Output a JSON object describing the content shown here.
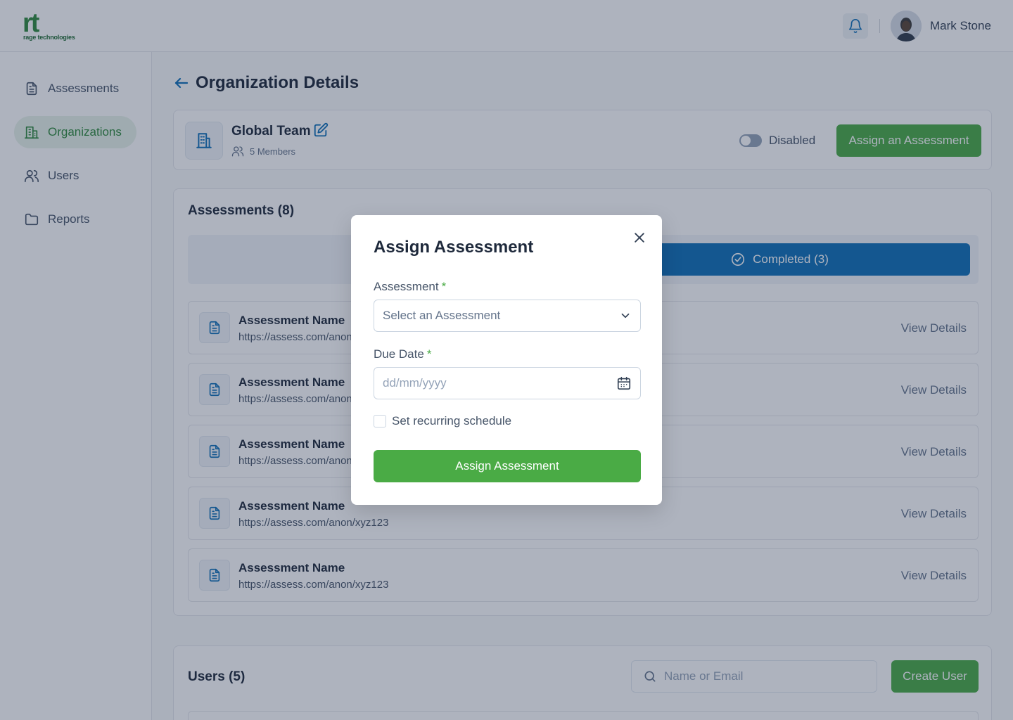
{
  "brand": {
    "logo_letters": "rt",
    "logo_text": "rage technologies",
    "accent": "#4aab45",
    "primary": "#0f6fb8"
  },
  "header": {
    "user_name": "Mark Stone"
  },
  "sidebar": {
    "items": [
      {
        "label": "Assessments",
        "icon": "document-icon"
      },
      {
        "label": "Organizations",
        "icon": "building-icon",
        "active": true
      },
      {
        "label": "Users",
        "icon": "users-icon"
      },
      {
        "label": "Reports",
        "icon": "folder-icon"
      }
    ]
  },
  "page": {
    "title": "Organization Details"
  },
  "org": {
    "name": "Global Team",
    "members": "5 Members",
    "status_label": "Disabled",
    "assign_label": "Assign an Assessment"
  },
  "assessments": {
    "title": "Assessments (8)",
    "tab_completed": "Completed (3)",
    "rows": [
      {
        "name": "Assessment Name",
        "url": "https://assess.com/anon/xyz123",
        "link": "View Details"
      },
      {
        "name": "Assessment Name",
        "url": "https://assess.com/anon/xyz123",
        "link": "View Details"
      },
      {
        "name": "Assessment Name",
        "url": "https://assess.com/anon/xyz123",
        "link": "View Details"
      },
      {
        "name": "Assessment Name",
        "url": "https://assess.com/anon/xyz123",
        "link": "View Details"
      },
      {
        "name": "Assessment Name",
        "url": "https://assess.com/anon/xyz123",
        "link": "View Details"
      }
    ]
  },
  "users": {
    "title": "Users (5)",
    "search_placeholder": "Name or Email",
    "create_label": "Create User"
  },
  "modal": {
    "title": "Assign Assessment",
    "assessment_label": "Assessment",
    "required_mark": "*",
    "assessment_placeholder": "Select an Assessment",
    "due_label": "Due Date",
    "due_placeholder": "dd/mm/yyyy",
    "recurring_label": "Set recurring schedule",
    "submit_label": "Assign Assessment"
  }
}
